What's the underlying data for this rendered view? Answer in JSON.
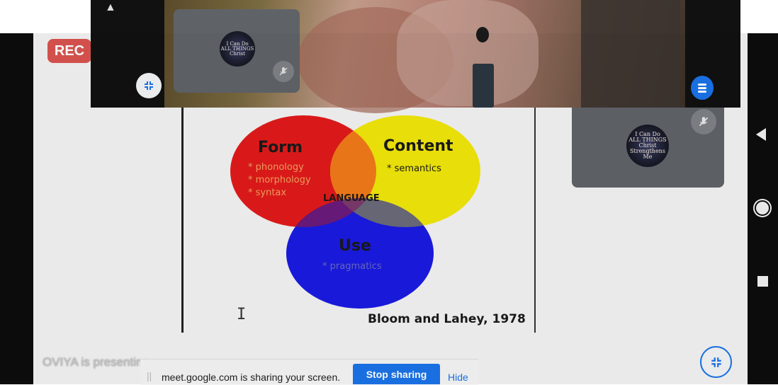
{
  "recording": {
    "label": "REC"
  },
  "self_tile": {
    "avatar_text": [
      "I Can Do",
      "ALL THINGS",
      "Christ"
    ]
  },
  "other_tile": {
    "avatar_text": [
      "I Can Do",
      "ALL THINGS",
      "Christ",
      "Strengthens Me"
    ]
  },
  "slide": {
    "circles": [
      {
        "name": "Form",
        "color": "#e11a1a",
        "items": [
          "* phonology",
          "* morphology",
          "* syntax"
        ]
      },
      {
        "name": "Content",
        "color": "#f0e60a",
        "items": [
          "* semantics"
        ]
      },
      {
        "name": "Use",
        "color": "#1a1ae0",
        "items": [
          "* pragmatics"
        ]
      }
    ],
    "center_label": "LANGUAGE",
    "citation": "Bloom and Lahey, 1978"
  },
  "presenting": {
    "status": "OVIYA is presenting",
    "share_message": "meet.google.com is sharing your screen.",
    "stop_label": "Stop sharing",
    "hide_label": "Hide"
  },
  "icons": {
    "collapse": "collapse-icon",
    "mic_off": "mic-off-icon",
    "menu": "menu-icon",
    "up_arrow": "up-arrow-icon",
    "nav_back": "back-triangle-icon",
    "nav_home": "home-circle-icon",
    "nav_recent": "recents-square-icon"
  }
}
